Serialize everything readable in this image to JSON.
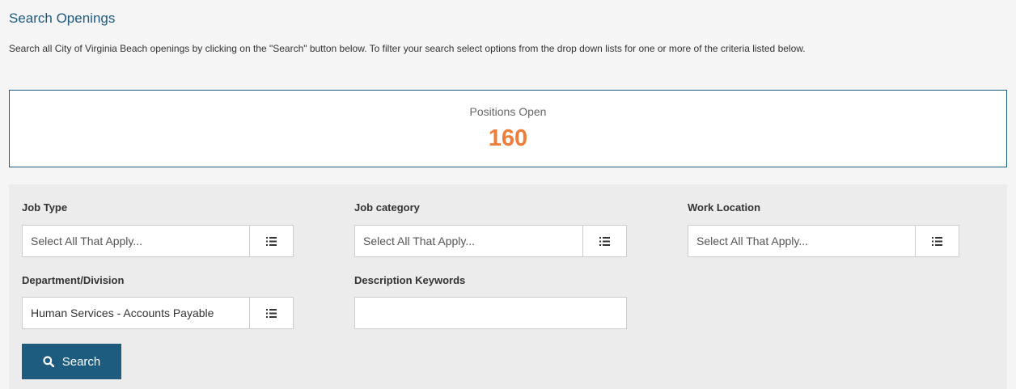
{
  "header": {
    "title": "Search Openings",
    "intro": "Search all City of Virginia Beach openings by clicking on the \"Search\" button below. To filter your search select options from the drop down lists for one or more of the criteria listed below."
  },
  "positions": {
    "label": "Positions Open",
    "count": "160"
  },
  "filters": {
    "job_type": {
      "label": "Job Type",
      "value": "Select All That Apply..."
    },
    "job_category": {
      "label": "Job category",
      "value": "Select All That Apply..."
    },
    "work_location": {
      "label": "Work Location",
      "value": "Select All That Apply..."
    },
    "department": {
      "label": "Department/Division",
      "value": "Human Services - Accounts Payable"
    },
    "keywords": {
      "label": "Description Keywords",
      "value": ""
    }
  },
  "search_button": {
    "label": "Search",
    "icon": "search-icon"
  },
  "colors": {
    "accent": "#1d5b7f",
    "count": "#ef7d3a",
    "panel": "#ececec",
    "background": "#f5f5f5"
  }
}
